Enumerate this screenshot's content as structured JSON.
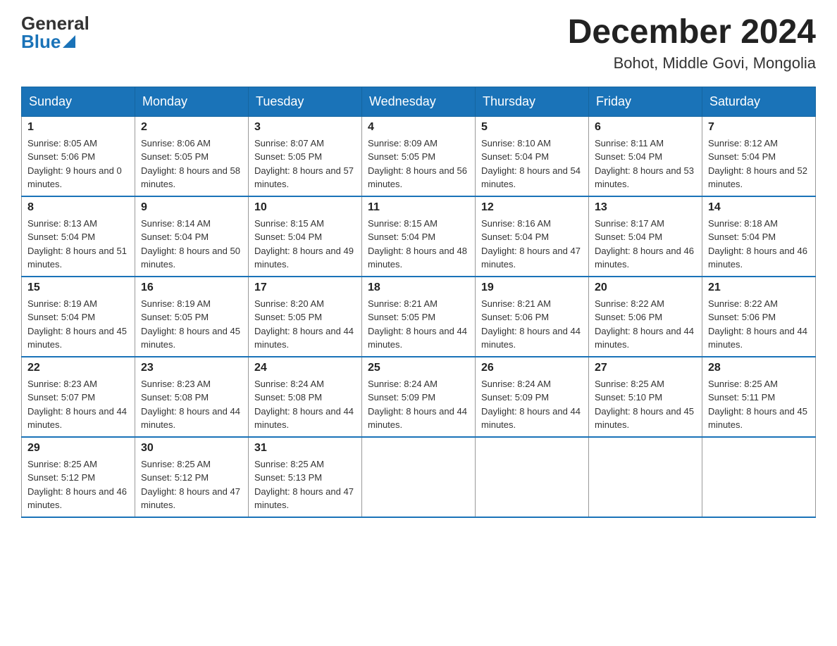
{
  "header": {
    "logo_general": "General",
    "logo_blue": "Blue",
    "month_title": "December 2024",
    "location": "Bohot, Middle Govi, Mongolia"
  },
  "calendar": {
    "days_of_week": [
      "Sunday",
      "Monday",
      "Tuesday",
      "Wednesday",
      "Thursday",
      "Friday",
      "Saturday"
    ],
    "weeks": [
      [
        {
          "day": "1",
          "sunrise": "Sunrise: 8:05 AM",
          "sunset": "Sunset: 5:06 PM",
          "daylight": "Daylight: 9 hours and 0 minutes."
        },
        {
          "day": "2",
          "sunrise": "Sunrise: 8:06 AM",
          "sunset": "Sunset: 5:05 PM",
          "daylight": "Daylight: 8 hours and 58 minutes."
        },
        {
          "day": "3",
          "sunrise": "Sunrise: 8:07 AM",
          "sunset": "Sunset: 5:05 PM",
          "daylight": "Daylight: 8 hours and 57 minutes."
        },
        {
          "day": "4",
          "sunrise": "Sunrise: 8:09 AM",
          "sunset": "Sunset: 5:05 PM",
          "daylight": "Daylight: 8 hours and 56 minutes."
        },
        {
          "day": "5",
          "sunrise": "Sunrise: 8:10 AM",
          "sunset": "Sunset: 5:04 PM",
          "daylight": "Daylight: 8 hours and 54 minutes."
        },
        {
          "day": "6",
          "sunrise": "Sunrise: 8:11 AM",
          "sunset": "Sunset: 5:04 PM",
          "daylight": "Daylight: 8 hours and 53 minutes."
        },
        {
          "day": "7",
          "sunrise": "Sunrise: 8:12 AM",
          "sunset": "Sunset: 5:04 PM",
          "daylight": "Daylight: 8 hours and 52 minutes."
        }
      ],
      [
        {
          "day": "8",
          "sunrise": "Sunrise: 8:13 AM",
          "sunset": "Sunset: 5:04 PM",
          "daylight": "Daylight: 8 hours and 51 minutes."
        },
        {
          "day": "9",
          "sunrise": "Sunrise: 8:14 AM",
          "sunset": "Sunset: 5:04 PM",
          "daylight": "Daylight: 8 hours and 50 minutes."
        },
        {
          "day": "10",
          "sunrise": "Sunrise: 8:15 AM",
          "sunset": "Sunset: 5:04 PM",
          "daylight": "Daylight: 8 hours and 49 minutes."
        },
        {
          "day": "11",
          "sunrise": "Sunrise: 8:15 AM",
          "sunset": "Sunset: 5:04 PM",
          "daylight": "Daylight: 8 hours and 48 minutes."
        },
        {
          "day": "12",
          "sunrise": "Sunrise: 8:16 AM",
          "sunset": "Sunset: 5:04 PM",
          "daylight": "Daylight: 8 hours and 47 minutes."
        },
        {
          "day": "13",
          "sunrise": "Sunrise: 8:17 AM",
          "sunset": "Sunset: 5:04 PM",
          "daylight": "Daylight: 8 hours and 46 minutes."
        },
        {
          "day": "14",
          "sunrise": "Sunrise: 8:18 AM",
          "sunset": "Sunset: 5:04 PM",
          "daylight": "Daylight: 8 hours and 46 minutes."
        }
      ],
      [
        {
          "day": "15",
          "sunrise": "Sunrise: 8:19 AM",
          "sunset": "Sunset: 5:04 PM",
          "daylight": "Daylight: 8 hours and 45 minutes."
        },
        {
          "day": "16",
          "sunrise": "Sunrise: 8:19 AM",
          "sunset": "Sunset: 5:05 PM",
          "daylight": "Daylight: 8 hours and 45 minutes."
        },
        {
          "day": "17",
          "sunrise": "Sunrise: 8:20 AM",
          "sunset": "Sunset: 5:05 PM",
          "daylight": "Daylight: 8 hours and 44 minutes."
        },
        {
          "day": "18",
          "sunrise": "Sunrise: 8:21 AM",
          "sunset": "Sunset: 5:05 PM",
          "daylight": "Daylight: 8 hours and 44 minutes."
        },
        {
          "day": "19",
          "sunrise": "Sunrise: 8:21 AM",
          "sunset": "Sunset: 5:06 PM",
          "daylight": "Daylight: 8 hours and 44 minutes."
        },
        {
          "day": "20",
          "sunrise": "Sunrise: 8:22 AM",
          "sunset": "Sunset: 5:06 PM",
          "daylight": "Daylight: 8 hours and 44 minutes."
        },
        {
          "day": "21",
          "sunrise": "Sunrise: 8:22 AM",
          "sunset": "Sunset: 5:06 PM",
          "daylight": "Daylight: 8 hours and 44 minutes."
        }
      ],
      [
        {
          "day": "22",
          "sunrise": "Sunrise: 8:23 AM",
          "sunset": "Sunset: 5:07 PM",
          "daylight": "Daylight: 8 hours and 44 minutes."
        },
        {
          "day": "23",
          "sunrise": "Sunrise: 8:23 AM",
          "sunset": "Sunset: 5:08 PM",
          "daylight": "Daylight: 8 hours and 44 minutes."
        },
        {
          "day": "24",
          "sunrise": "Sunrise: 8:24 AM",
          "sunset": "Sunset: 5:08 PM",
          "daylight": "Daylight: 8 hours and 44 minutes."
        },
        {
          "day": "25",
          "sunrise": "Sunrise: 8:24 AM",
          "sunset": "Sunset: 5:09 PM",
          "daylight": "Daylight: 8 hours and 44 minutes."
        },
        {
          "day": "26",
          "sunrise": "Sunrise: 8:24 AM",
          "sunset": "Sunset: 5:09 PM",
          "daylight": "Daylight: 8 hours and 44 minutes."
        },
        {
          "day": "27",
          "sunrise": "Sunrise: 8:25 AM",
          "sunset": "Sunset: 5:10 PM",
          "daylight": "Daylight: 8 hours and 45 minutes."
        },
        {
          "day": "28",
          "sunrise": "Sunrise: 8:25 AM",
          "sunset": "Sunset: 5:11 PM",
          "daylight": "Daylight: 8 hours and 45 minutes."
        }
      ],
      [
        {
          "day": "29",
          "sunrise": "Sunrise: 8:25 AM",
          "sunset": "Sunset: 5:12 PM",
          "daylight": "Daylight: 8 hours and 46 minutes."
        },
        {
          "day": "30",
          "sunrise": "Sunrise: 8:25 AM",
          "sunset": "Sunset: 5:12 PM",
          "daylight": "Daylight: 8 hours and 47 minutes."
        },
        {
          "day": "31",
          "sunrise": "Sunrise: 8:25 AM",
          "sunset": "Sunset: 5:13 PM",
          "daylight": "Daylight: 8 hours and 47 minutes."
        },
        null,
        null,
        null,
        null
      ]
    ]
  }
}
